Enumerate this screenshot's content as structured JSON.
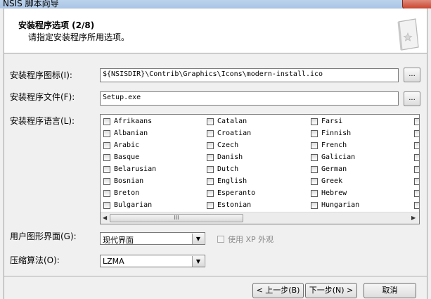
{
  "window": {
    "title": "NSIS 脚本向导"
  },
  "header": {
    "title": "安装程序选项 (2/8)",
    "subtitle": "请指定安装程序所用选项。"
  },
  "form": {
    "icon_label": "安装程序图标(I):",
    "icon_value": "${NSISDIR}\\Contrib\\Graphics\\Icons\\modern-install.ico",
    "file_label": "安装程序文件(F):",
    "file_value": "Setup.exe",
    "browse_label": "...",
    "lang_label": "安装程序语言(L):",
    "languages": [
      [
        "Afrikaans",
        "Catalan",
        "Farsi"
      ],
      [
        "Albanian",
        "Croatian",
        "Finnish"
      ],
      [
        "Arabic",
        "Czech",
        "French"
      ],
      [
        "Basque",
        "Danish",
        "Galician"
      ],
      [
        "Belarusian",
        "Dutch",
        "German"
      ],
      [
        "Bosnian",
        "English",
        "Greek"
      ],
      [
        "Breton",
        "Esperanto",
        "Hebrew"
      ],
      [
        "Bulgarian",
        "Estonian",
        "Hungarian"
      ]
    ],
    "scroll_thumb_grip": "III",
    "ui_label": "用户图形界面(G):",
    "ui_value": "现代界面",
    "xp_label": "使用 XP 外观",
    "compress_label": "压缩算法(O):",
    "compress_value": "LZMA"
  },
  "buttons": {
    "back": "< 上一步(B)",
    "next": "下一步(N) >",
    "cancel": "取消"
  },
  "icons": {
    "header": "wizard-book-icon",
    "dropdown": "chevron-down-icon"
  }
}
